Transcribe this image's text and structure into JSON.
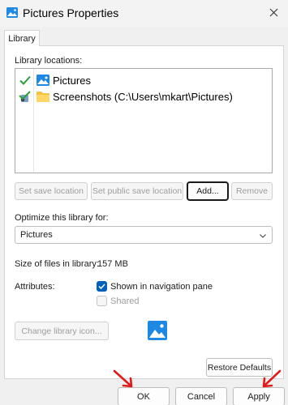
{
  "window": {
    "title": "Pictures Properties",
    "icon": "pictures-library-icon",
    "close_glyph": "✕"
  },
  "tabs": [
    {
      "label": "Library",
      "selected": true
    }
  ],
  "library_locations": {
    "label": "Library locations:",
    "items": [
      {
        "text": "Pictures",
        "status_icon": "green-check-icon",
        "type_icon": "pictures-folder-icon"
      },
      {
        "text": "Screenshots (C:\\Users\\mkart\\Pictures)",
        "status_icon": "public-save-check-icon",
        "type_icon": "yellow-folder-icon"
      }
    ]
  },
  "location_buttons": {
    "set_save": "Set save location",
    "set_public": "Set public save location",
    "add": "Add...",
    "remove": "Remove"
  },
  "optimize": {
    "label": "Optimize this library for:",
    "value": "Pictures"
  },
  "size": {
    "label": "Size of files in library:",
    "value": "157 MB"
  },
  "attributes": {
    "label": "Attributes:",
    "shown_in_nav": {
      "label": "Shown in navigation pane",
      "checked": true
    },
    "shared": {
      "label": "Shared",
      "checked": false,
      "disabled": true
    }
  },
  "change_icon_button": "Change library icon...",
  "restore_defaults": "Restore Defaults",
  "dialog_buttons": {
    "ok": "OK",
    "cancel": "Cancel",
    "apply": "Apply"
  },
  "colors": {
    "accent": "#005fb8",
    "arrow_red": "#e01b1b",
    "check_green": "#2e9e3e",
    "folder_yellow": "#f5c242"
  }
}
